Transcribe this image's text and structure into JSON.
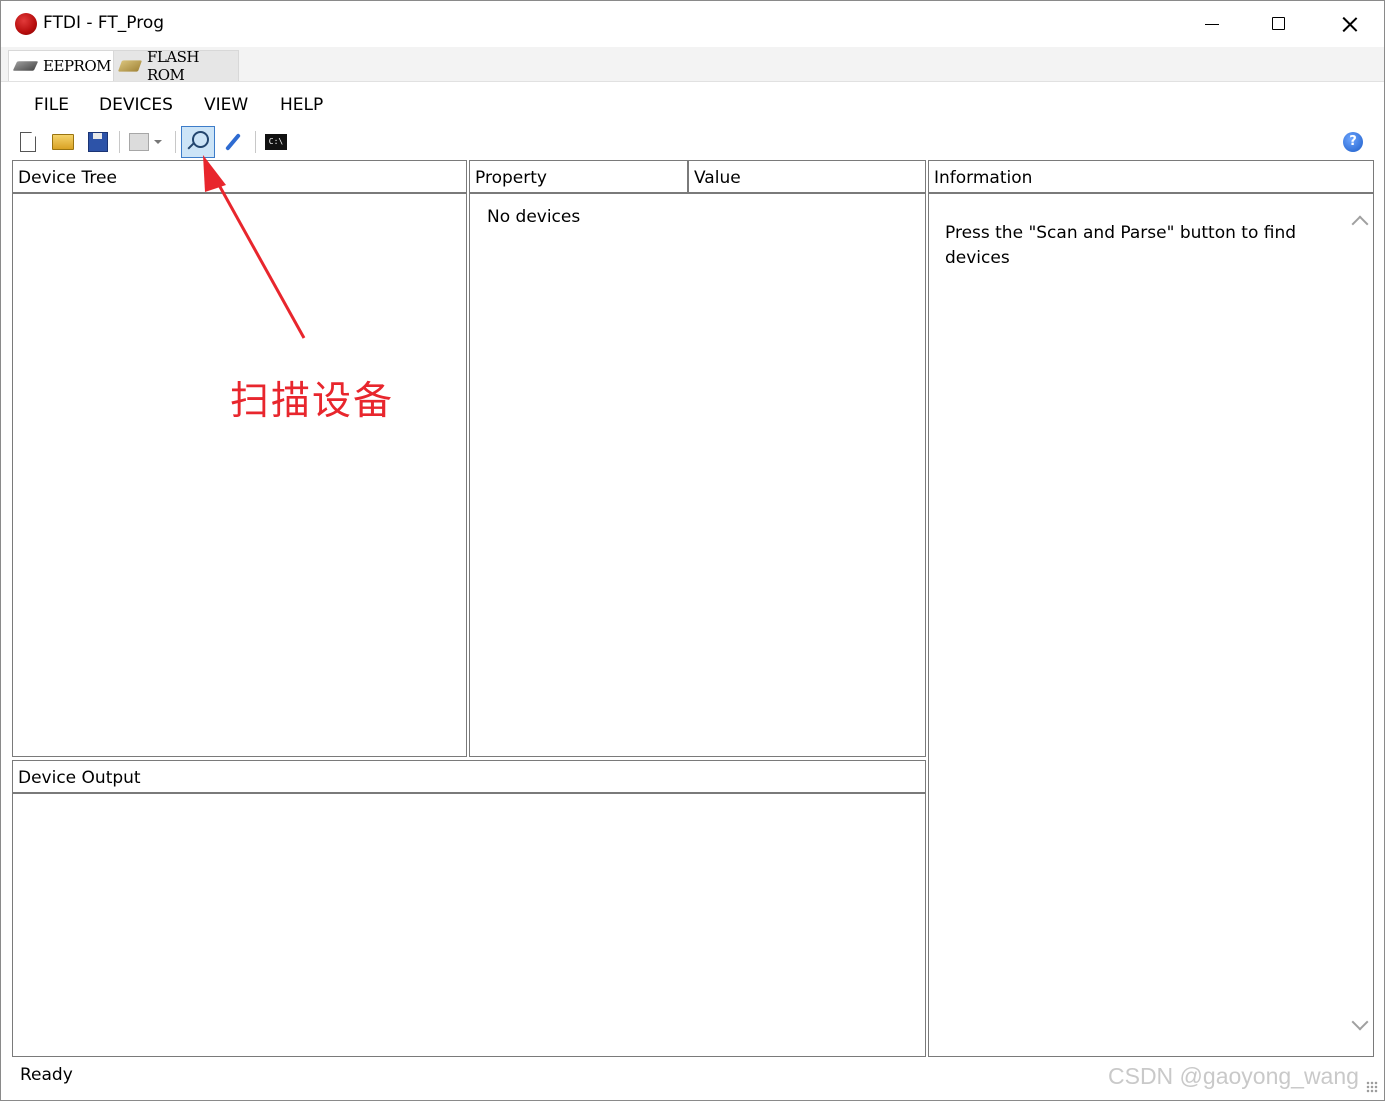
{
  "window": {
    "title": "FTDI - FT_Prog"
  },
  "tabs": [
    {
      "label": "EEPROM",
      "icon": "chip-icon",
      "active": true
    },
    {
      "label": "FLASH ROM",
      "icon": "flash-chip-icon",
      "active": false
    }
  ],
  "menu": [
    "FILE",
    "DEVICES",
    "VIEW",
    "HELP"
  ],
  "toolbar": {
    "buttons": [
      "new-icon",
      "open-folder-icon",
      "save-icon",
      "copy-icon",
      "scan-parse-icon",
      "program-devices-icon",
      "command-prompt-icon",
      "help-icon"
    ],
    "cmd_icon_text": "C:\\",
    "help_glyph": "?",
    "active_button": "scan-parse-icon"
  },
  "device_tree": {
    "header": "Device Tree"
  },
  "properties": {
    "col_property": "Property",
    "col_value": "Value",
    "empty_text": "No devices"
  },
  "information": {
    "header": "Information",
    "text": "Press the \"Scan and Parse\" button to find devices"
  },
  "output": {
    "header": "Device Output"
  },
  "status": {
    "text": "Ready"
  },
  "annotation": {
    "label": "扫描设备",
    "color": "#e8262d"
  },
  "watermark": "CSDN @gaoyong_wang",
  "colors": {
    "border": "#7a7a7a",
    "selected_button_bg": "#cce4f7",
    "selected_button_border": "#3d7cc9"
  }
}
